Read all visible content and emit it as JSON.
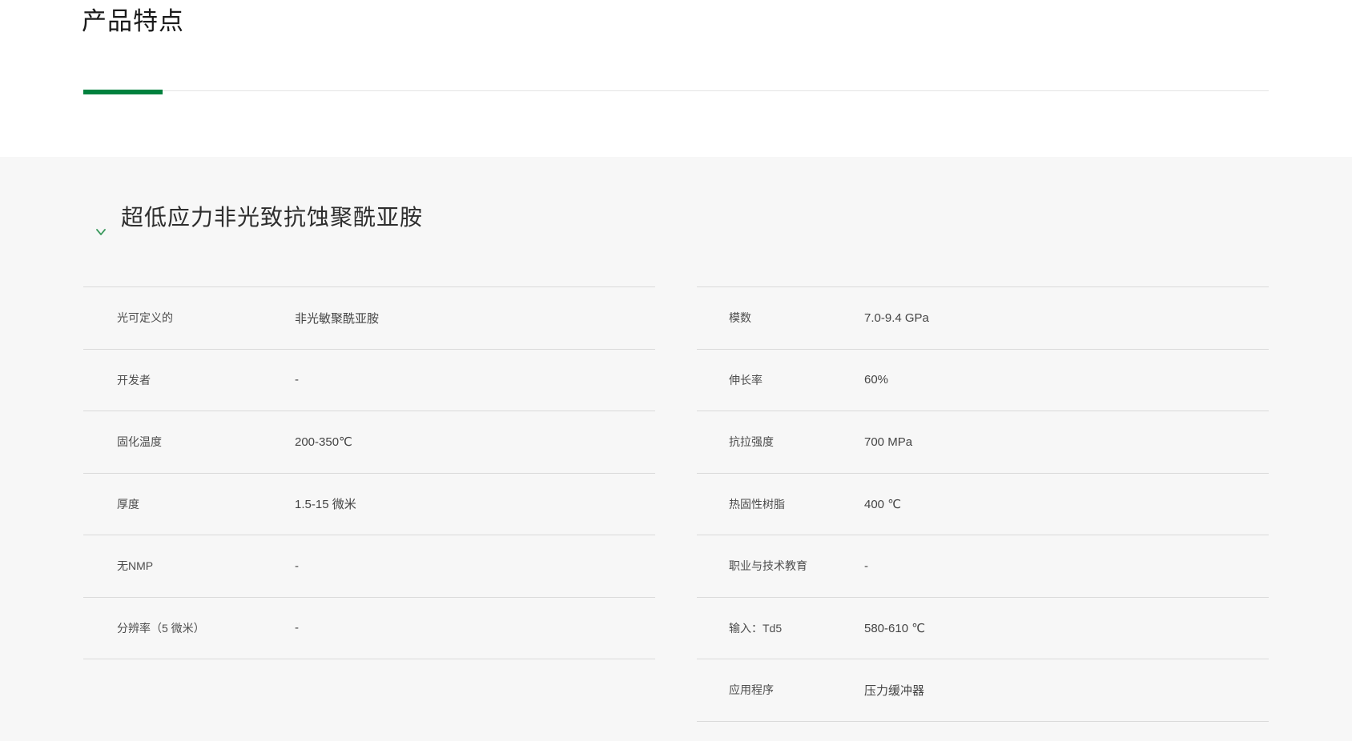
{
  "page": {
    "title": "产品特点"
  },
  "section": {
    "title": "超低应力非光致抗蚀聚酰亚胺",
    "state": "expanded"
  },
  "icons": {
    "section_toggle": "chevron-down"
  },
  "colors": {
    "accent_green": "#00813e",
    "chevron_green": "#3d9a5f",
    "section_background": "#f7f7f7",
    "divider": "#dadada",
    "rule_gray": "#e3e3e3"
  },
  "spec_tables": {
    "left": [
      {
        "label": "光可定义的",
        "value": "非光敏聚酰亚胺"
      },
      {
        "label": "开发者",
        "value": "-"
      },
      {
        "label": "固化温度",
        "value": "200-350℃"
      },
      {
        "label": "厚度",
        "value": "1.5-15 微米"
      },
      {
        "label": "无NMP",
        "value": "-"
      },
      {
        "label": "分辨率（5 微米）",
        "value": "-"
      }
    ],
    "right": [
      {
        "label": "模数",
        "value": "7.0-9.4 GPa"
      },
      {
        "label": "伸长率",
        "value": "60%"
      },
      {
        "label": "抗拉强度",
        "value": "700 MPa"
      },
      {
        "label": "热固性树脂",
        "value": "400 ℃"
      },
      {
        "label": "职业与技术教育",
        "value": "-"
      },
      {
        "label": "输入：Td5",
        "value": "580-610 ℃"
      },
      {
        "label": "应用程序",
        "value": "压力缓冲器"
      }
    ]
  }
}
